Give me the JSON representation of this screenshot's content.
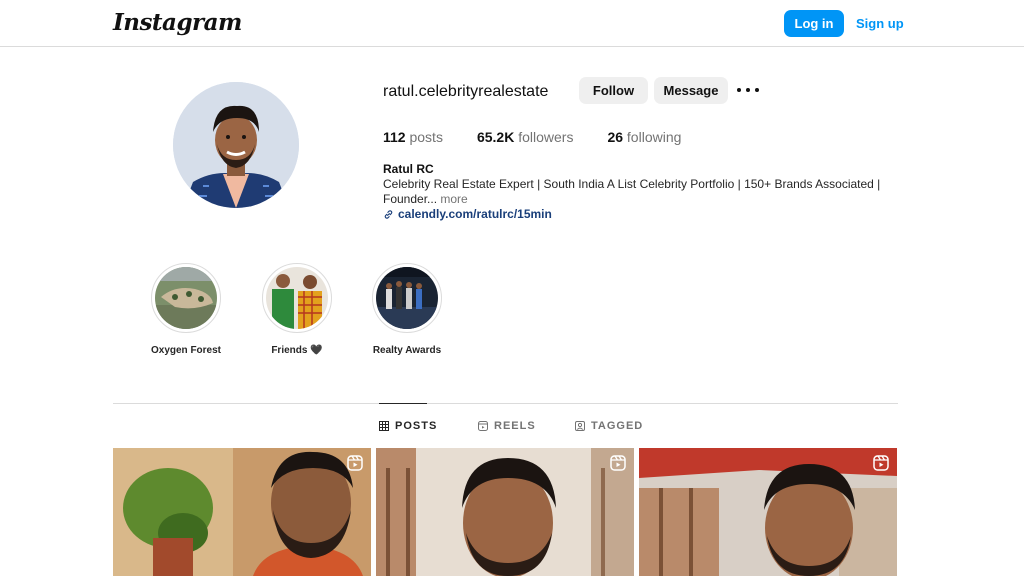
{
  "header": {
    "logo": "Instagram",
    "login_label": "Log in",
    "signup_label": "Sign up"
  },
  "profile": {
    "username": "ratul.celebrityrealestate",
    "follow_label": "Follow",
    "message_label": "Message",
    "stats": {
      "posts_count": "112",
      "posts_label": "posts",
      "followers_count": "65.2K",
      "followers_label": "followers",
      "following_count": "26",
      "following_label": "following"
    },
    "full_name": "Ratul RC",
    "bio_line1": "Celebrity Real Estate Expert | South India A List Celebrity Portfolio | 150+ Brands Associated |",
    "bio_line2": "Founder...",
    "bio_more": "more",
    "link": "calendly.com/ratulrc/15min"
  },
  "highlights": [
    {
      "label": "Oxygen Forest"
    },
    {
      "label": "Friends 🖤"
    },
    {
      "label": "Realty Awards"
    }
  ],
  "tabs": [
    {
      "label": "POSTS",
      "active": true,
      "icon": "grid-icon"
    },
    {
      "label": "REELS",
      "active": false,
      "icon": "reels-icon"
    },
    {
      "label": "TAGGED",
      "active": false,
      "icon": "tagged-icon"
    }
  ],
  "colors": {
    "accent": "#0095f6",
    "link": "#1a3f7a",
    "border": "#dbdbdb",
    "secondary_text": "#737373"
  }
}
